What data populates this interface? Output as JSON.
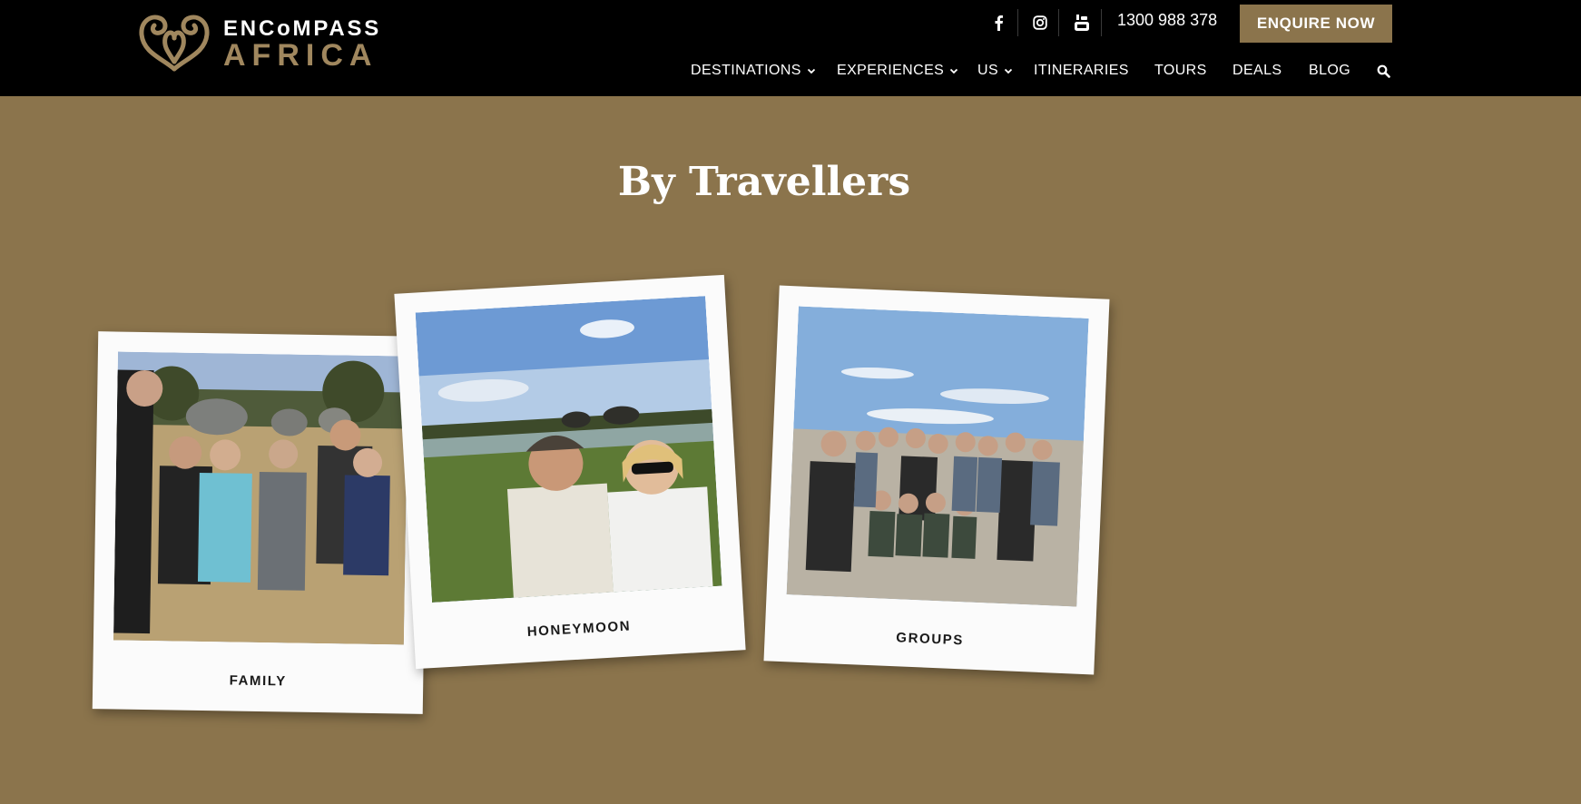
{
  "header": {
    "logo": {
      "line1": "ENCoMPASS",
      "line2": "AFRICA"
    },
    "social": {
      "facebook": "facebook-icon",
      "instagram": "instagram-icon",
      "youtube": "youtube-icon"
    },
    "phone": "1300 988 378",
    "enquire_label": "ENQUIRE NOW",
    "nav": [
      {
        "label": "DESTINATIONS",
        "dropdown": true
      },
      {
        "label": "EXPERIENCES",
        "dropdown": true
      },
      {
        "label": "US",
        "dropdown": true
      },
      {
        "label": "ITINERARIES",
        "dropdown": false
      },
      {
        "label": "TOURS",
        "dropdown": false
      },
      {
        "label": "DEALS",
        "dropdown": false
      },
      {
        "label": "BLOG",
        "dropdown": false
      }
    ],
    "search_icon": "search-icon"
  },
  "section": {
    "title": "By Travellers",
    "cards": [
      {
        "label": "FAMILY"
      },
      {
        "label": "HONEYMOON"
      },
      {
        "label": "GROUPS"
      }
    ]
  },
  "colors": {
    "header_bg": "#000000",
    "page_bg": "#8B744C",
    "brand_gold": "#A0875E",
    "card_bg": "#FBFBFB"
  }
}
